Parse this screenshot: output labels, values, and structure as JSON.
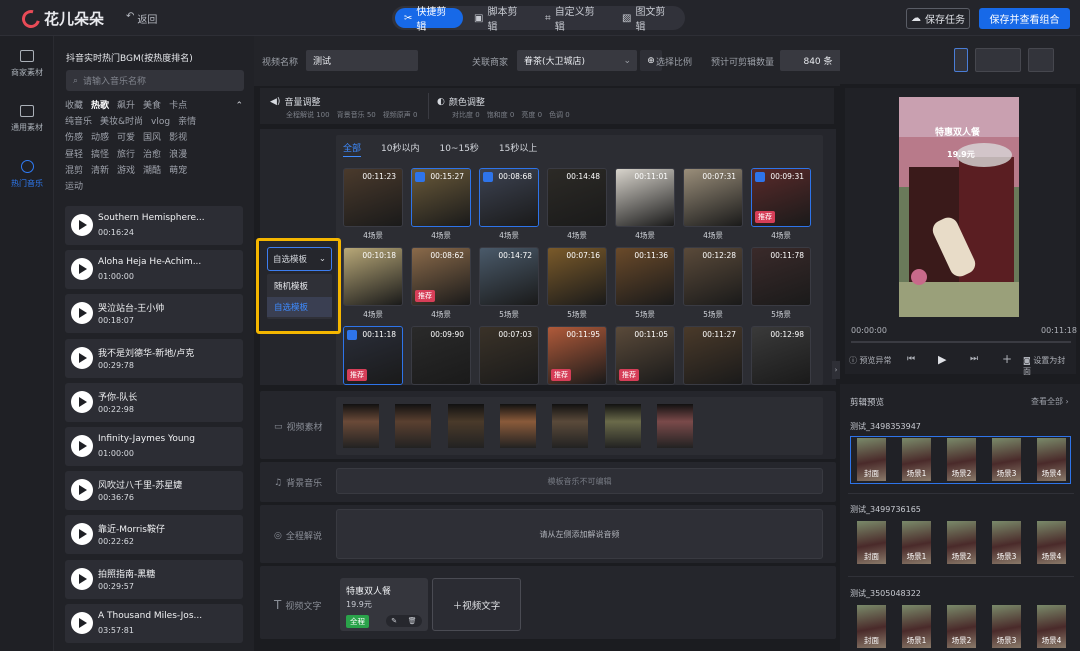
{
  "header": {
    "app_name": "花儿朵朵",
    "back_label": "返回",
    "modes": [
      "快捷剪辑",
      "脚本剪辑",
      "自定义剪辑",
      "图文剪辑"
    ],
    "active_mode": "快捷剪辑",
    "save_task_label": "保存任务",
    "save_combo_label": "保存并查看组合"
  },
  "left_nav": {
    "items": [
      {
        "label": "商家素材",
        "icon": "merchant-material-icon"
      },
      {
        "label": "通用素材",
        "icon": "general-material-icon"
      },
      {
        "label": "热门音乐",
        "icon": "music-icon",
        "active": true
      }
    ]
  },
  "music": {
    "title": "抖音实时热门BGM(按热度排名)",
    "search_placeholder": "请输入音乐名称",
    "tags": [
      "收藏",
      "热歌",
      "飙升",
      "美食",
      "卡点",
      "纯音乐",
      "美妆&时尚",
      "vlog",
      "亲情",
      "伤感",
      "动感",
      "可爱",
      "国风",
      "影视",
      "昼轻",
      "搞怪",
      "旅行",
      "治愈",
      "浪漫",
      "混剪",
      "清新",
      "游戏",
      "潮酷",
      "萌宠",
      "运动"
    ],
    "active_tag": "热歌",
    "songs": [
      {
        "title": "Southern Hemisphere...",
        "duration": "00:16:24"
      },
      {
        "title": "Aloha Heja He-Achim...",
        "duration": "01:00:00"
      },
      {
        "title": "哭泣站台-王小帅",
        "duration": "00:18:07"
      },
      {
        "title": "我不是刘德华-新地/卢克",
        "duration": "00:29:78"
      },
      {
        "title": "予你-队长",
        "duration": "00:22:98"
      },
      {
        "title": "Infinity-Jaymes Young",
        "duration": "01:00:00"
      },
      {
        "title": "风吹过八千里-苏星婕",
        "duration": "00:36:76"
      },
      {
        "title": "靠近-Morris鞍仔",
        "duration": "00:22:62"
      },
      {
        "title": "拍照指南-黑糖",
        "duration": "00:29:57"
      },
      {
        "title": "A Thousand Miles-Jos...",
        "duration": "03:57:81"
      }
    ]
  },
  "params": {
    "video_name_label": "视频名称",
    "video_name_value": "测试",
    "merchant_label": "关联商家",
    "merchant_value": "眷茶(大卫城店)",
    "estimate_label": "预计可剪辑数量",
    "estimate_value": "840 条",
    "ratio_label": "选择比例"
  },
  "adjust": {
    "audio_title": "音量调整",
    "audio_sub": [
      "全程解说 100",
      "背景音乐 50",
      "视频原声 0"
    ],
    "color_title": "颜色调整",
    "color_sub": [
      "对比度 0",
      "饱和度 0",
      "亮度 0",
      "色调 0"
    ]
  },
  "templates": {
    "tabs": [
      "全部",
      "10秒以内",
      "10~15秒",
      "15秒以上"
    ],
    "active_tab": "全部",
    "dropdown_value": "自选模板",
    "dropdown_options": [
      "随机模板",
      "自选模板"
    ],
    "recommend_badge": "推荐",
    "items": [
      {
        "dur": "00:11:23",
        "cap": "4场景",
        "checked": false,
        "badge": false,
        "color": "#4a3a2c"
      },
      {
        "dur": "00:15:27",
        "cap": "4场景",
        "checked": true,
        "badge": false,
        "color": "#6a5a3a"
      },
      {
        "dur": "00:08:68",
        "cap": "4场景",
        "checked": true,
        "badge": false,
        "color": "#3d4352"
      },
      {
        "dur": "00:14:48",
        "cap": "4场景",
        "checked": false,
        "badge": false,
        "color": "#2c2a26"
      },
      {
        "dur": "00:11:01",
        "cap": "4场景",
        "checked": false,
        "badge": false,
        "color": "#d8d4cc"
      },
      {
        "dur": "00:07:31",
        "cap": "4场景",
        "checked": false,
        "badge": false,
        "color": "#9a8e7a"
      },
      {
        "dur": "00:09:31",
        "cap": "4场景",
        "checked": true,
        "badge": true,
        "color": "#5a2a2a"
      },
      {
        "dur": "00:10:18",
        "cap": "4场景",
        "checked": false,
        "badge": false,
        "color": "#b8a878"
      },
      {
        "dur": "00:08:62",
        "cap": "4场景",
        "checked": false,
        "badge": true,
        "color": "#8a6a4a"
      },
      {
        "dur": "00:14:72",
        "cap": "5场景",
        "checked": false,
        "badge": false,
        "color": "#4a5a6a"
      },
      {
        "dur": "00:07:16",
        "cap": "5场景",
        "checked": false,
        "badge": false,
        "color": "#7a5a2a"
      },
      {
        "dur": "00:11:36",
        "cap": "5场景",
        "checked": false,
        "badge": false,
        "color": "#6a4a2a"
      },
      {
        "dur": "00:12:28",
        "cap": "5场景",
        "checked": false,
        "badge": false,
        "color": "#5a4a3a"
      },
      {
        "dur": "00:11:78",
        "cap": "5场景",
        "checked": false,
        "badge": false,
        "color": "#3a2a2a"
      },
      {
        "dur": "00:11:18",
        "cap": "",
        "checked": true,
        "badge": true,
        "color": "#2a2e3a"
      },
      {
        "dur": "00:09:90",
        "cap": "",
        "checked": false,
        "badge": false,
        "color": "#2a2a2a"
      },
      {
        "dur": "00:07:03",
        "cap": "",
        "checked": false,
        "badge": false,
        "color": "#3a3228"
      },
      {
        "dur": "00:11:95",
        "cap": "",
        "checked": false,
        "badge": true,
        "color": "#b05a3a"
      },
      {
        "dur": "00:11:05",
        "cap": "",
        "checked": false,
        "badge": true,
        "color": "#5a4a3a"
      },
      {
        "dur": "00:11:27",
        "cap": "",
        "checked": false,
        "badge": false,
        "color": "#4a3a2a"
      },
      {
        "dur": "00:12:98",
        "cap": "",
        "checked": false,
        "badge": false,
        "color": "#3a3a3a"
      }
    ]
  },
  "rows": {
    "material_label": "视频素材",
    "music_label": "背景音乐",
    "music_hint": "模板音乐不可编辑",
    "narration_label": "全程解说",
    "narration_hint": "请从左侧添加解说音频",
    "text_label": "视频文字",
    "text_card_title": "特惠双人餐",
    "text_card_price": "19.9元",
    "text_card_tag": "全程",
    "add_text_label": "＋视频文字",
    "clip_colors": [
      "#6a4a38",
      "#5a4030",
      "#4a3a2a",
      "#8a5a3a",
      "#5a4a3a",
      "#6a6a4a",
      "#7a4a4a"
    ]
  },
  "preview": {
    "overlay_title": "特惠双人餐",
    "overlay_price": "19.9元",
    "time_start": "00:00:00",
    "time_end": "00:11:18",
    "report_label": "预览异常",
    "cover_label": "设置为封面",
    "clip_preview_title": "剪辑预览",
    "view_all_label": "查看全部 ›",
    "groups": [
      {
        "name": "测试_3498353947",
        "labels": [
          "封面",
          "场景1",
          "场景2",
          "场景3",
          "场景4"
        ]
      },
      {
        "name": "测试_3499736165",
        "labels": [
          "封面",
          "场景1",
          "场景2",
          "场景3",
          "场景4"
        ]
      },
      {
        "name": "测试_3505048322",
        "labels": [
          "封面",
          "场景1",
          "场景2",
          "场景3",
          "场景4"
        ]
      }
    ]
  }
}
